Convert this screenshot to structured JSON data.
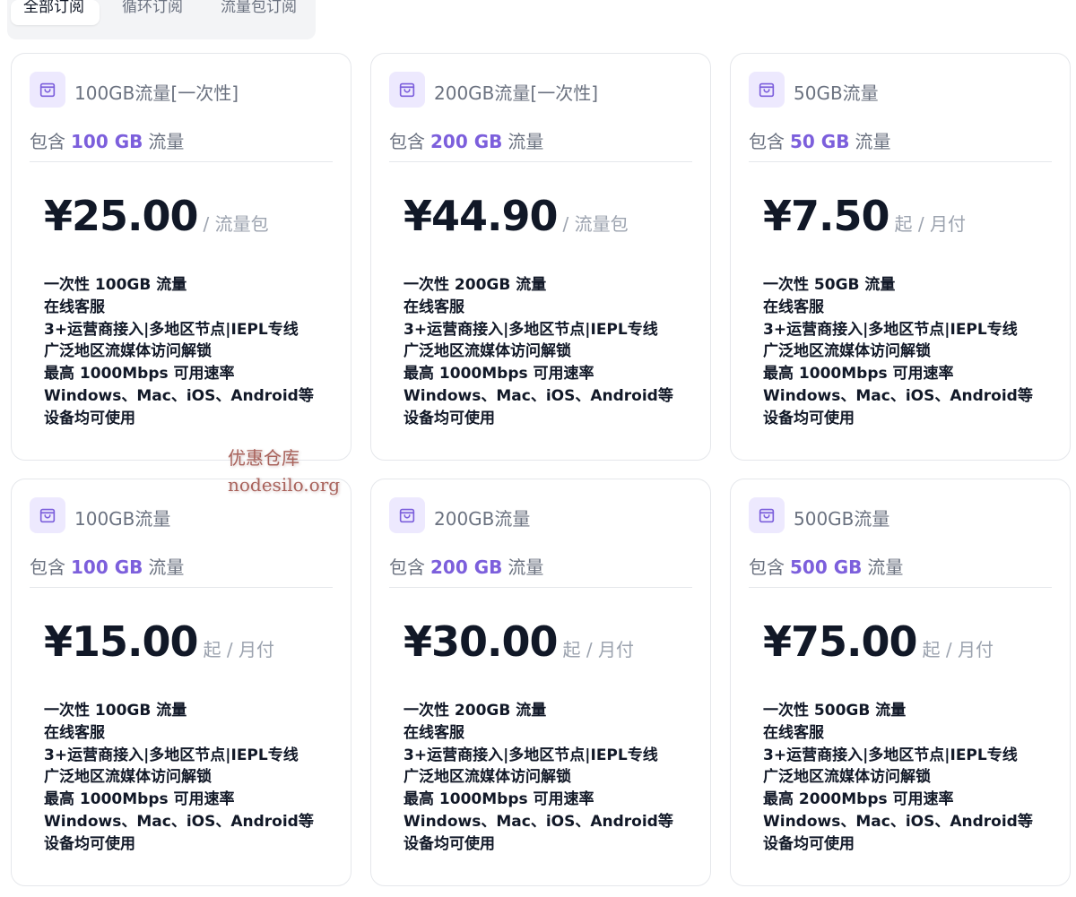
{
  "tabs": [
    {
      "label": "全部订阅",
      "active": true
    },
    {
      "label": "循环订阅",
      "active": false
    },
    {
      "label": "流量包订阅",
      "active": false
    }
  ],
  "accent_color": "#7c5fdc",
  "icon": "shopping-bag-icon",
  "cards": [
    {
      "title": "100GB流量[一次性]",
      "includes_prefix": "包含",
      "includes_amount": "100 GB",
      "includes_suffix": "流量",
      "price": "¥25.00",
      "price_unit": "/ 流量包",
      "features": [
        "一次性 100GB 流量",
        "在线客服",
        "3+运营商接入|多地区节点|IEPL专线",
        "广泛地区流媒体访问解锁",
        "最高 1000Mbps 可用速率",
        "Windows、Mac、iOS、Android等",
        "设备均可使用"
      ]
    },
    {
      "title": "200GB流量[一次性]",
      "includes_prefix": "包含",
      "includes_amount": "200 GB",
      "includes_suffix": "流量",
      "price": "¥44.90",
      "price_unit": "/ 流量包",
      "features": [
        "一次性 200GB 流量",
        "在线客服",
        "3+运营商接入|多地区节点|IEPL专线",
        "广泛地区流媒体访问解锁",
        "最高 1000Mbps 可用速率",
        "Windows、Mac、iOS、Android等",
        "设备均可使用"
      ]
    },
    {
      "title": "50GB流量",
      "includes_prefix": "包含",
      "includes_amount": "50 GB",
      "includes_suffix": "流量",
      "price": "¥7.50",
      "price_unit": "起 / 月付",
      "features": [
        "一次性 50GB 流量",
        "在线客服",
        "3+运营商接入|多地区节点|IEPL专线",
        "广泛地区流媒体访问解锁",
        "最高 1000Mbps 可用速率",
        "Windows、Mac、iOS、Android等",
        "设备均可使用"
      ]
    },
    {
      "title": "100GB流量",
      "includes_prefix": "包含",
      "includes_amount": "100 GB",
      "includes_suffix": "流量",
      "price": "¥15.00",
      "price_unit": "起 / 月付",
      "features": [
        "一次性 100GB 流量",
        "在线客服",
        "3+运营商接入|多地区节点|IEPL专线",
        "广泛地区流媒体访问解锁",
        "最高 1000Mbps 可用速率",
        "Windows、Mac、iOS、Android等",
        "设备均可使用"
      ]
    },
    {
      "title": "200GB流量",
      "includes_prefix": "包含",
      "includes_amount": "200 GB",
      "includes_suffix": "流量",
      "price": "¥30.00",
      "price_unit": "起 / 月付",
      "features": [
        "一次性 200GB 流量",
        "在线客服",
        "3+运营商接入|多地区节点|IEPL专线",
        "广泛地区流媒体访问解锁",
        "最高 1000Mbps 可用速率",
        "Windows、Mac、iOS、Android等",
        "设备均可使用"
      ]
    },
    {
      "title": "500GB流量",
      "includes_prefix": "包含",
      "includes_amount": "500 GB",
      "includes_suffix": "流量",
      "price": "¥75.00",
      "price_unit": "起 / 月付",
      "features": [
        "一次性 500GB 流量",
        "在线客服",
        "3+运营商接入|多地区节点|IEPL专线",
        "广泛地区流媒体访问解锁",
        "最高 2000Mbps 可用速率",
        "Windows、Mac、iOS、Android等",
        "设备均可使用"
      ]
    }
  ],
  "watermark": {
    "line1": "优惠仓库",
    "line2": "nodesilo.org"
  }
}
